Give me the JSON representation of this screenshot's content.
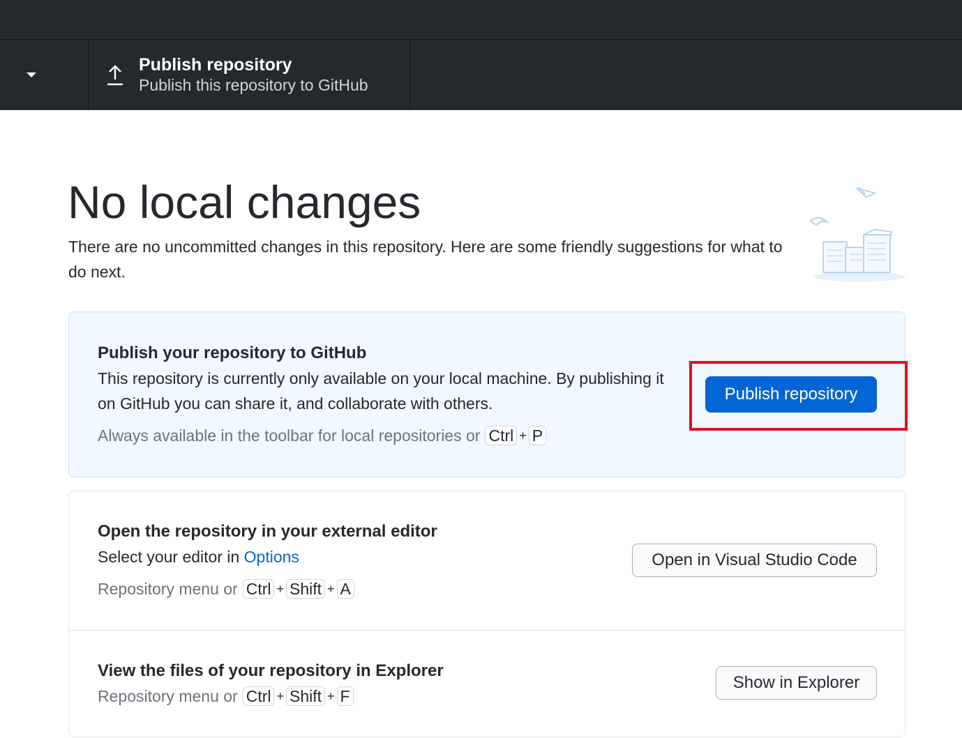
{
  "toolbar": {
    "publish_title": "Publish repository",
    "publish_subtitle": "Publish this repository to GitHub"
  },
  "main": {
    "heading": "No local changes",
    "intro": "There are no uncommitted changes in this repository. Here are some friendly suggestions for what to do next."
  },
  "publish_card": {
    "title": "Publish your repository to GitHub",
    "description": "This repository is currently only available on your local machine. By publishing it on GitHub you can share it, and collaborate with others.",
    "hint_prefix": "Always available in the toolbar for local repositories or",
    "keys": [
      "Ctrl",
      "P"
    ],
    "button_label": "Publish repository"
  },
  "editor_card": {
    "title": "Open the repository in your external editor",
    "description_prefix": "Select your editor in",
    "options_link": "Options",
    "hint_prefix": "Repository menu or",
    "keys": [
      "Ctrl",
      "Shift",
      "A"
    ],
    "button_label": "Open in Visual Studio Code"
  },
  "explorer_card": {
    "title": "View the files of your repository in Explorer",
    "hint_prefix": "Repository menu or",
    "keys": [
      "Ctrl",
      "Shift",
      "F"
    ],
    "button_label": "Show in Explorer"
  },
  "plus_sign": "+",
  "colors": {
    "toolbar_bg": "#24292e",
    "accent": "#0366d6",
    "publish_card_bg": "#f1f8ff",
    "highlight": "#e0101e"
  }
}
